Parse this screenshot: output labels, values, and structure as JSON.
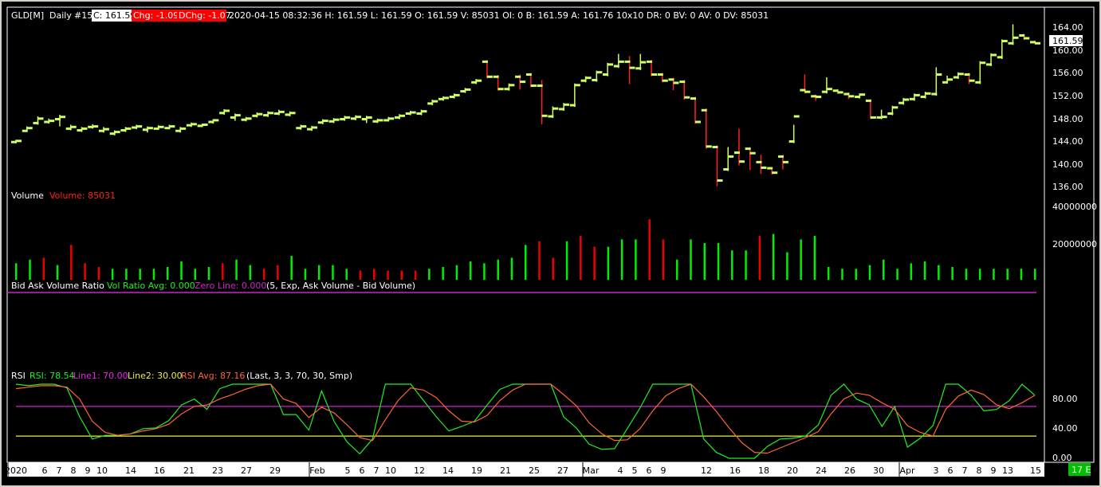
{
  "header": {
    "symbol": "GLD[M]",
    "period": "Daily",
    "bars_back": "#15",
    "close": "C: 161.59",
    "chg": "Chg: -1.09",
    "dchg": "DChg: -1.07",
    "quote": "2020-04-15 08:32:36 H: 161.59 L: 161.59 O: 161.59 V: 85031 OI: 0 B: 161.59 A: 161.76 10x10 DR: 0 BV: 0 AV: 0 DV: 85031"
  },
  "price_axis": {
    "ticks": [
      "164.00",
      "160.00",
      "156.00",
      "152.00",
      "148.00",
      "144.00",
      "140.00",
      "136.00"
    ],
    "last_price": "161.59"
  },
  "volume_panel": {
    "title": "Volume",
    "value_label": "Volume: 85031",
    "ticks": [
      "40000000",
      "20000000"
    ]
  },
  "bav_panel": {
    "title": "Bid Ask Volume Ratio",
    "avg_label": "Vol Ratio Avg: 0.000",
    "zero_label": "Zero Line: 0.000",
    "params": "(5, Exp, Ask Volume - Bid Volume)"
  },
  "rsi_panel": {
    "title": "RSI",
    "rsi_label": "RSI: 78.54",
    "line1_label": "Line1: 70.00",
    "line2_label": "Line2: 30.00",
    "avg_label": "RSI Avg: 87.16",
    "params": "(Last, 3, 3, 70, 30, Smp)",
    "ticks": [
      "80.00",
      "40.00",
      "0.00"
    ]
  },
  "date_axis": {
    "labels": [
      "2020",
      "6",
      "7",
      "8",
      "9",
      "10",
      "14",
      "16",
      "21",
      "23",
      "27",
      "29",
      "Feb",
      "5",
      "6",
      "7",
      "10",
      "12",
      "14",
      "19",
      "21",
      "25",
      "27",
      "Mar",
      "4",
      "5",
      "6",
      "9",
      "12",
      "16",
      "18",
      "20",
      "24",
      "26",
      "30",
      "Apr",
      "3",
      "6",
      "7",
      "8",
      "9",
      "13",
      "15"
    ],
    "corner_badge": "17 E"
  },
  "colors": {
    "background": "#000000",
    "bar_up": "#ccff66",
    "bar_down": "#ff2020",
    "volume_up": "#00ee00",
    "volume_down": "#ee0000",
    "rsi_line": "#22ee22",
    "rsi_avg": "#ff6633",
    "line1": "#cc22cc",
    "line2": "#eeee44",
    "zero_line": "#cc22cc"
  },
  "chart_data": [
    {
      "type": "ohlc",
      "series": [
        {
          "name": "GLD[M]",
          "open": [
            143.9,
            145.9,
            147.3,
            147.5,
            148.0,
            146.3,
            146.0,
            146.6,
            145.9,
            145.4,
            146.0,
            146.5,
            146.1,
            146.3,
            146.4,
            145.9,
            146.9,
            146.8,
            147.5,
            149.1,
            148.3,
            147.9,
            148.6,
            148.7,
            149.0,
            148.8,
            146.4,
            146.2,
            147.4,
            147.6,
            148.0,
            148.1,
            148.0,
            147.6,
            147.8,
            148.3,
            149.0,
            149.0,
            150.8,
            151.6,
            152.0,
            153.0,
            154.6,
            158.3,
            155.6,
            153.4,
            155.6,
            156.0,
            154.0,
            148.5,
            149.8,
            150.5,
            154.9,
            155.0,
            156.0,
            157.5,
            158.3,
            157.1,
            158.3,
            156.0,
            155.1,
            154.7,
            151.7,
            149.6,
            143.0,
            139.0,
            142.0,
            142.7,
            140.3,
            139.2,
            141.3,
            144.0,
            153.2,
            152.1,
            152.9,
            153.1,
            152.5,
            152.0,
            151.3,
            148.3,
            149.0,
            150.9,
            151.6,
            152.0,
            152.5,
            154.6,
            155.5,
            156.0,
            154.6,
            157.8,
            159.1,
            161.6,
            163.0,
            161.8
          ],
          "close": [
            144.1,
            146.4,
            148.1,
            147.7,
            148.4,
            146.6,
            146.3,
            146.7,
            146.2,
            145.7,
            146.3,
            146.7,
            146.4,
            146.6,
            146.7,
            146.3,
            147.1,
            147.0,
            147.8,
            149.5,
            148.7,
            148.1,
            148.9,
            149.1,
            149.3,
            149.1,
            146.7,
            146.5,
            147.7,
            147.9,
            148.3,
            148.4,
            148.3,
            147.8,
            148.1,
            148.6,
            149.2,
            149.4,
            151.2,
            151.8,
            152.3,
            153.3,
            154.9,
            155.6,
            153.4,
            154.1,
            154.7,
            154.0,
            148.6,
            149.9,
            150.6,
            154.1,
            155.4,
            156.4,
            157.8,
            158.3,
            157.2,
            158.2,
            156.0,
            154.9,
            154.5,
            151.9,
            147.5,
            143.1,
            137.0,
            141.3,
            140.4,
            141.9,
            139.3,
            138.4,
            140.3,
            148.5,
            152.9,
            152.0,
            153.4,
            152.8,
            152.1,
            152.4,
            148.3,
            148.4,
            150.1,
            151.5,
            152.3,
            152.6,
            156.0,
            155.1,
            156.1,
            154.9,
            158.1,
            159.5,
            162.0,
            162.6,
            162.5,
            161.6
          ],
          "high": [
            144.3,
            146.7,
            148.5,
            148.1,
            148.8,
            147.0,
            146.6,
            147.1,
            146.6,
            146.0,
            146.6,
            147.0,
            146.7,
            146.9,
            147.0,
            146.6,
            147.4,
            147.2,
            148.0,
            149.8,
            149.0,
            148.4,
            149.2,
            149.4,
            149.7,
            149.4,
            147.0,
            146.8,
            148.0,
            148.2,
            148.6,
            148.7,
            148.6,
            148.1,
            148.4,
            148.9,
            149.5,
            149.7,
            151.5,
            152.1,
            152.6,
            153.6,
            155.2,
            158.6,
            155.9,
            154.4,
            156.0,
            156.3,
            155.0,
            150.3,
            150.9,
            154.4,
            155.7,
            156.7,
            158.1,
            159.7,
            159.3,
            159.7,
            158.6,
            156.3,
            155.4,
            155.0,
            152.0,
            149.9,
            143.3,
            143.0,
            146.3,
            143.0,
            141.6,
            139.4,
            141.6,
            147.0,
            156.0,
            152.4,
            155.5,
            153.4,
            152.8,
            152.6,
            151.6,
            149.7,
            150.4,
            151.8,
            152.6,
            152.9,
            157.3,
            155.8,
            156.4,
            156.3,
            158.4,
            159.8,
            162.3,
            165.0,
            163.3,
            162.1
          ],
          "low": [
            143.7,
            145.7,
            147.0,
            147.2,
            146.7,
            146.0,
            145.7,
            146.3,
            145.6,
            145.1,
            145.7,
            146.2,
            145.6,
            146.1,
            146.2,
            145.6,
            146.6,
            146.6,
            147.2,
            148.8,
            147.7,
            147.6,
            148.3,
            148.4,
            148.7,
            148.5,
            146.1,
            145.9,
            147.1,
            147.3,
            147.7,
            147.8,
            147.3,
            147.3,
            147.6,
            148.0,
            148.7,
            148.7,
            150.5,
            151.3,
            151.7,
            152.7,
            154.3,
            155.3,
            153.1,
            153.1,
            153.3,
            153.7,
            147.1,
            148.2,
            149.5,
            150.2,
            154.6,
            154.7,
            155.7,
            157.2,
            154.3,
            156.8,
            155.7,
            154.6,
            153.2,
            151.5,
            147.2,
            142.7,
            136.0,
            138.7,
            139.7,
            138.9,
            138.2,
            138.1,
            139.0,
            143.7,
            152.6,
            151.3,
            152.6,
            152.5,
            151.6,
            151.7,
            148.0,
            148.0,
            148.7,
            150.6,
            151.3,
            151.7,
            152.2,
            154.4,
            155.2,
            154.3,
            154.3,
            157.5,
            158.8,
            161.3,
            162.2,
            161.5
          ]
        }
      ],
      "ylim": [
        135.5,
        165.5
      ]
    },
    {
      "type": "bar",
      "series": [
        {
          "name": "Volume",
          "values": [
            9,
            11,
            12,
            8,
            19,
            9,
            7,
            6,
            6,
            6,
            6,
            7,
            10,
            6,
            7,
            9,
            11,
            8,
            6,
            8,
            13,
            6,
            8,
            8,
            6,
            5,
            6,
            5,
            5,
            5,
            6,
            7,
            8,
            10,
            9,
            11,
            12,
            19,
            21,
            12,
            21,
            24,
            18,
            18,
            22,
            22,
            33,
            22,
            11,
            22,
            20,
            20,
            16,
            16,
            24,
            25,
            15,
            22,
            24,
            7,
            6,
            6,
            8,
            11,
            6,
            9,
            10,
            8,
            7,
            6,
            6,
            6,
            6,
            6,
            6
          ],
          "up": [
            1,
            1,
            0,
            1,
            0,
            0,
            0,
            1,
            1,
            1,
            1,
            1,
            1,
            1,
            1,
            0,
            1,
            1,
            0,
            0,
            1,
            1,
            1,
            1,
            1,
            0,
            0,
            0,
            0,
            0,
            1,
            1,
            1,
            1,
            1,
            1,
            1,
            1,
            0,
            0,
            1,
            0,
            0,
            1,
            1,
            1,
            0,
            0,
            1,
            1,
            1,
            1,
            1,
            1,
            0,
            1,
            1,
            1,
            1,
            1,
            1,
            1,
            1,
            1,
            1,
            1,
            1,
            1,
            1,
            1,
            1,
            1,
            1,
            1,
            1
          ]
        }
      ],
      "ylim": [
        0,
        45000000
      ]
    },
    {
      "type": "line",
      "series": [
        {
          "name": "RSI",
          "values": [
            100,
            98,
            100,
            100,
            95,
            56,
            26,
            31,
            31,
            33,
            40,
            41,
            51,
            72,
            80,
            66,
            94,
            100,
            100,
            100,
            100,
            59,
            59,
            38,
            91,
            49,
            22,
            6,
            26,
            100,
            100,
            100,
            78,
            56,
            37,
            43,
            50,
            72,
            93,
            100,
            100,
            100,
            100,
            56,
            41,
            19,
            12,
            13,
            40,
            68,
            100,
            100,
            100,
            100,
            26,
            8,
            0,
            0,
            0,
            16,
            26,
            27,
            30,
            45,
            85,
            100,
            80,
            72,
            43,
            70,
            15,
            27,
            44,
            100,
            100,
            85,
            64,
            66,
            78,
            100,
            85
          ]
        },
        {
          "name": "RSI Avg",
          "values": [
            94,
            96,
            98,
            98,
            96,
            80,
            50,
            35,
            31,
            33,
            37,
            40,
            46,
            60,
            70,
            72,
            80,
            86,
            93,
            98,
            100,
            80,
            74,
            55,
            69,
            61,
            45,
            28,
            24,
            52,
            78,
            95,
            92,
            82,
            64,
            50,
            49,
            58,
            78,
            92,
            100,
            100,
            100,
            86,
            71,
            48,
            33,
            24,
            25,
            40,
            64,
            84,
            94,
            100,
            83,
            63,
            41,
            21,
            8,
            7,
            14,
            21,
            28,
            36,
            60,
            80,
            88,
            85,
            75,
            66,
            44,
            35,
            30,
            66,
            84,
            92,
            86,
            72,
            67,
            75,
            85
          ]
        }
      ],
      "line1": 70,
      "line2": 30,
      "ylim": [
        0,
        100
      ]
    }
  ]
}
